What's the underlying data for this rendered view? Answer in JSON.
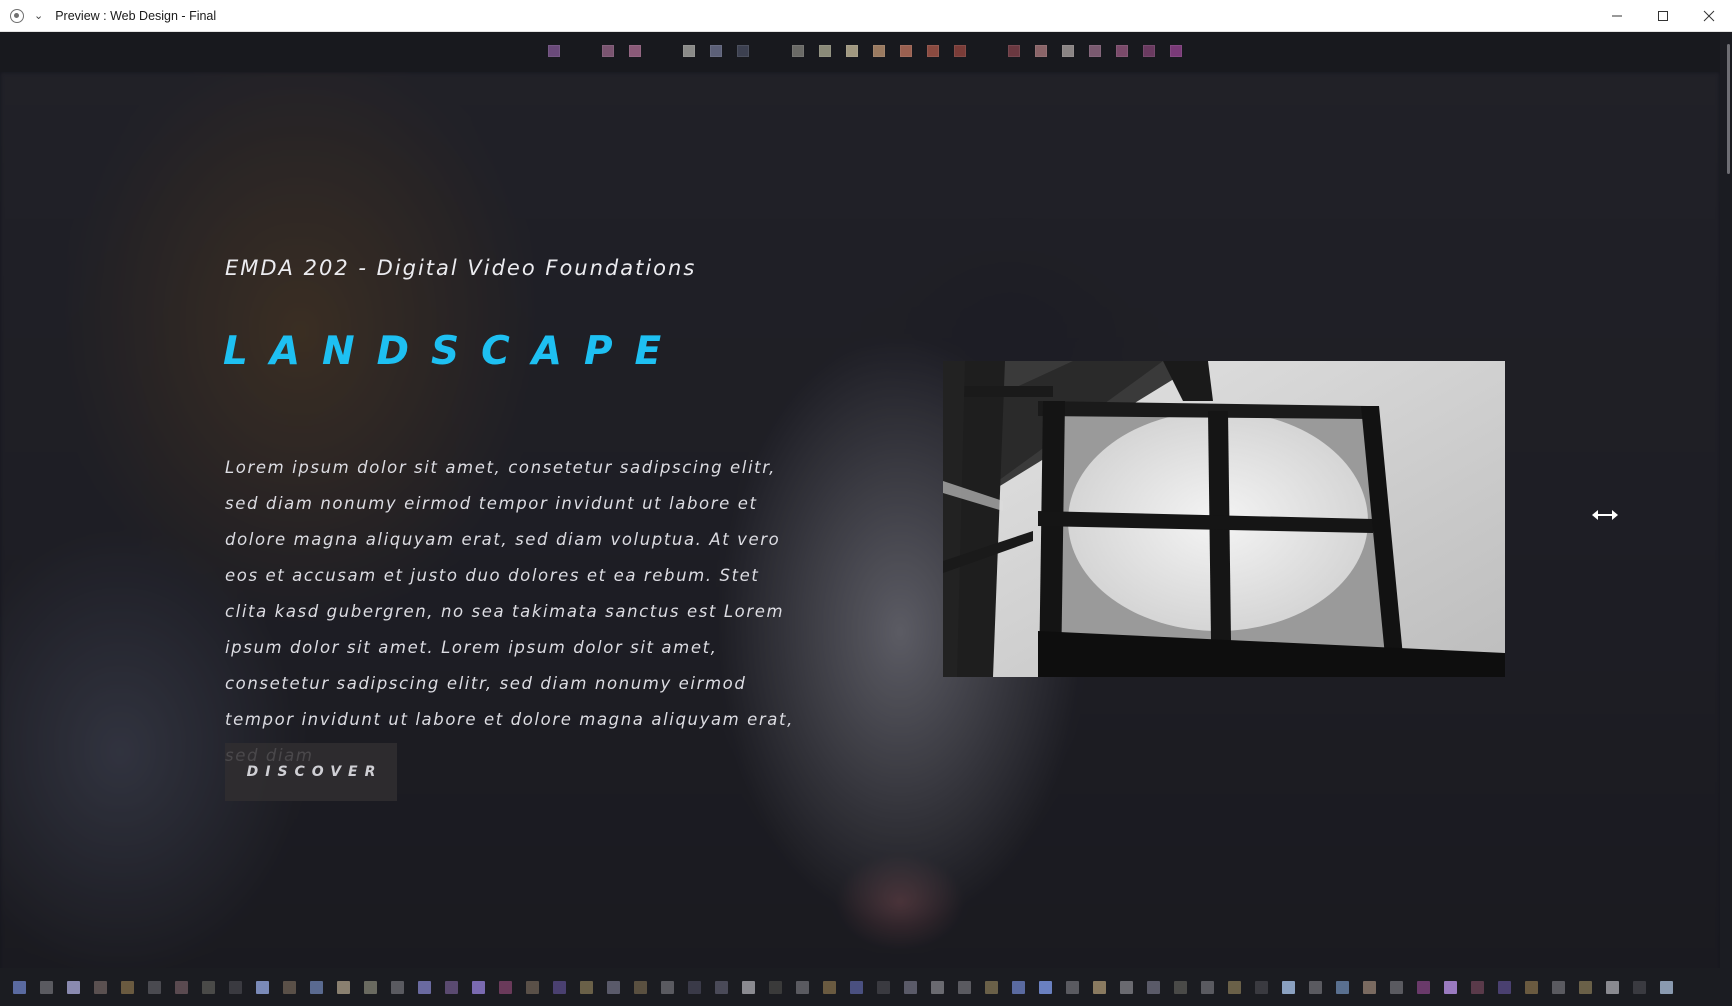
{
  "window": {
    "title": "Preview : Web Design - Final",
    "controls": [
      "minimize-icon",
      "maximize-icon",
      "close-icon"
    ]
  },
  "hero": {
    "course_title": "EMDA 202 - Digital Video Foundations",
    "headline": "LANDSCAPE",
    "body": "Lorem ipsum dolor sit amet, consetetur sadipscing elitr, sed diam nonumy eirmod tempor invidunt ut labore et dolore magna aliquyam erat, sed diam voluptua. At vero eos et accusam et justo duo dolores et ea rebum. Stet clita kasd gubergren, no sea takimata sanctus est Lorem ipsum dolor sit amet. Lorem ipsum dolor sit amet, consetetur sadipscing elitr, sed diam nonumy eirmod tempor invidunt ut labore et dolore magna aliquyam erat, sed diam",
    "button_label": "DISCOVER",
    "image_subject": "window-with-circle-photo"
  },
  "colors": {
    "accent": "#1ec0f2",
    "background": "#1a1c24",
    "button_bg": "#302e30"
  },
  "top_swatches": [
    "#6a4a7a",
    "#7a5470",
    "#8a5a78",
    "#8a8a88",
    "#5c6078",
    "#3c4050",
    "#6a6a66",
    "#8a8a78",
    "#a09880",
    "#9a7a60",
    "#9a6050",
    "#8a4a40",
    "#7a3c38",
    "#6a3840",
    "#8a6468",
    "#8a8484",
    "#7a5a70",
    "#7a4a6a",
    "#6a3a60",
    "#7a3a78"
  ],
  "bottom_thumbnails": [
    "#5a6aa0",
    "#5a5a60",
    "#8a8ab0",
    "#5a5050",
    "#6a5a40",
    "#4a4a50",
    "#5a4a50",
    "#4a4a48",
    "#3a3a40",
    "#7a8ab8",
    "#5a5048",
    "#5a6a90",
    "#8a8070",
    "#6a6a60",
    "#5a5a60",
    "#6a6aa0",
    "#5a4a70",
    "#7a6ab0",
    "#6a3a5a",
    "#5a5048",
    "#4a4070",
    "#6a6048",
    "#5a5a6a",
    "#5a5040",
    "#5a5a60",
    "#3a3a48",
    "#4a4a58",
    "#8a8a90",
    "#3a3a3a",
    "#5a5a60",
    "#6a5a40",
    "#4a5080",
    "#3a3a40",
    "#5a5a68",
    "#6a6a70",
    "#5a5a60",
    "#6a6048",
    "#5a6aa0",
    "#6a80c0",
    "#5a5a60",
    "#8a7a60",
    "#6a6a70",
    "#5a5a68",
    "#4a4a48",
    "#5a5a60",
    "#6a6048",
    "#3a3a40",
    "#8aa0c0",
    "#5a5a60",
    "#5a7090",
    "#7a6a60",
    "#5a5a60",
    "#6a3a6a",
    "#9a7ac0",
    "#5a3a4a",
    "#4a4070",
    "#6a5a40",
    "#5a5a60",
    "#6a6048",
    "#8a8a90",
    "#3a3a40",
    "#8a9ab0"
  ]
}
